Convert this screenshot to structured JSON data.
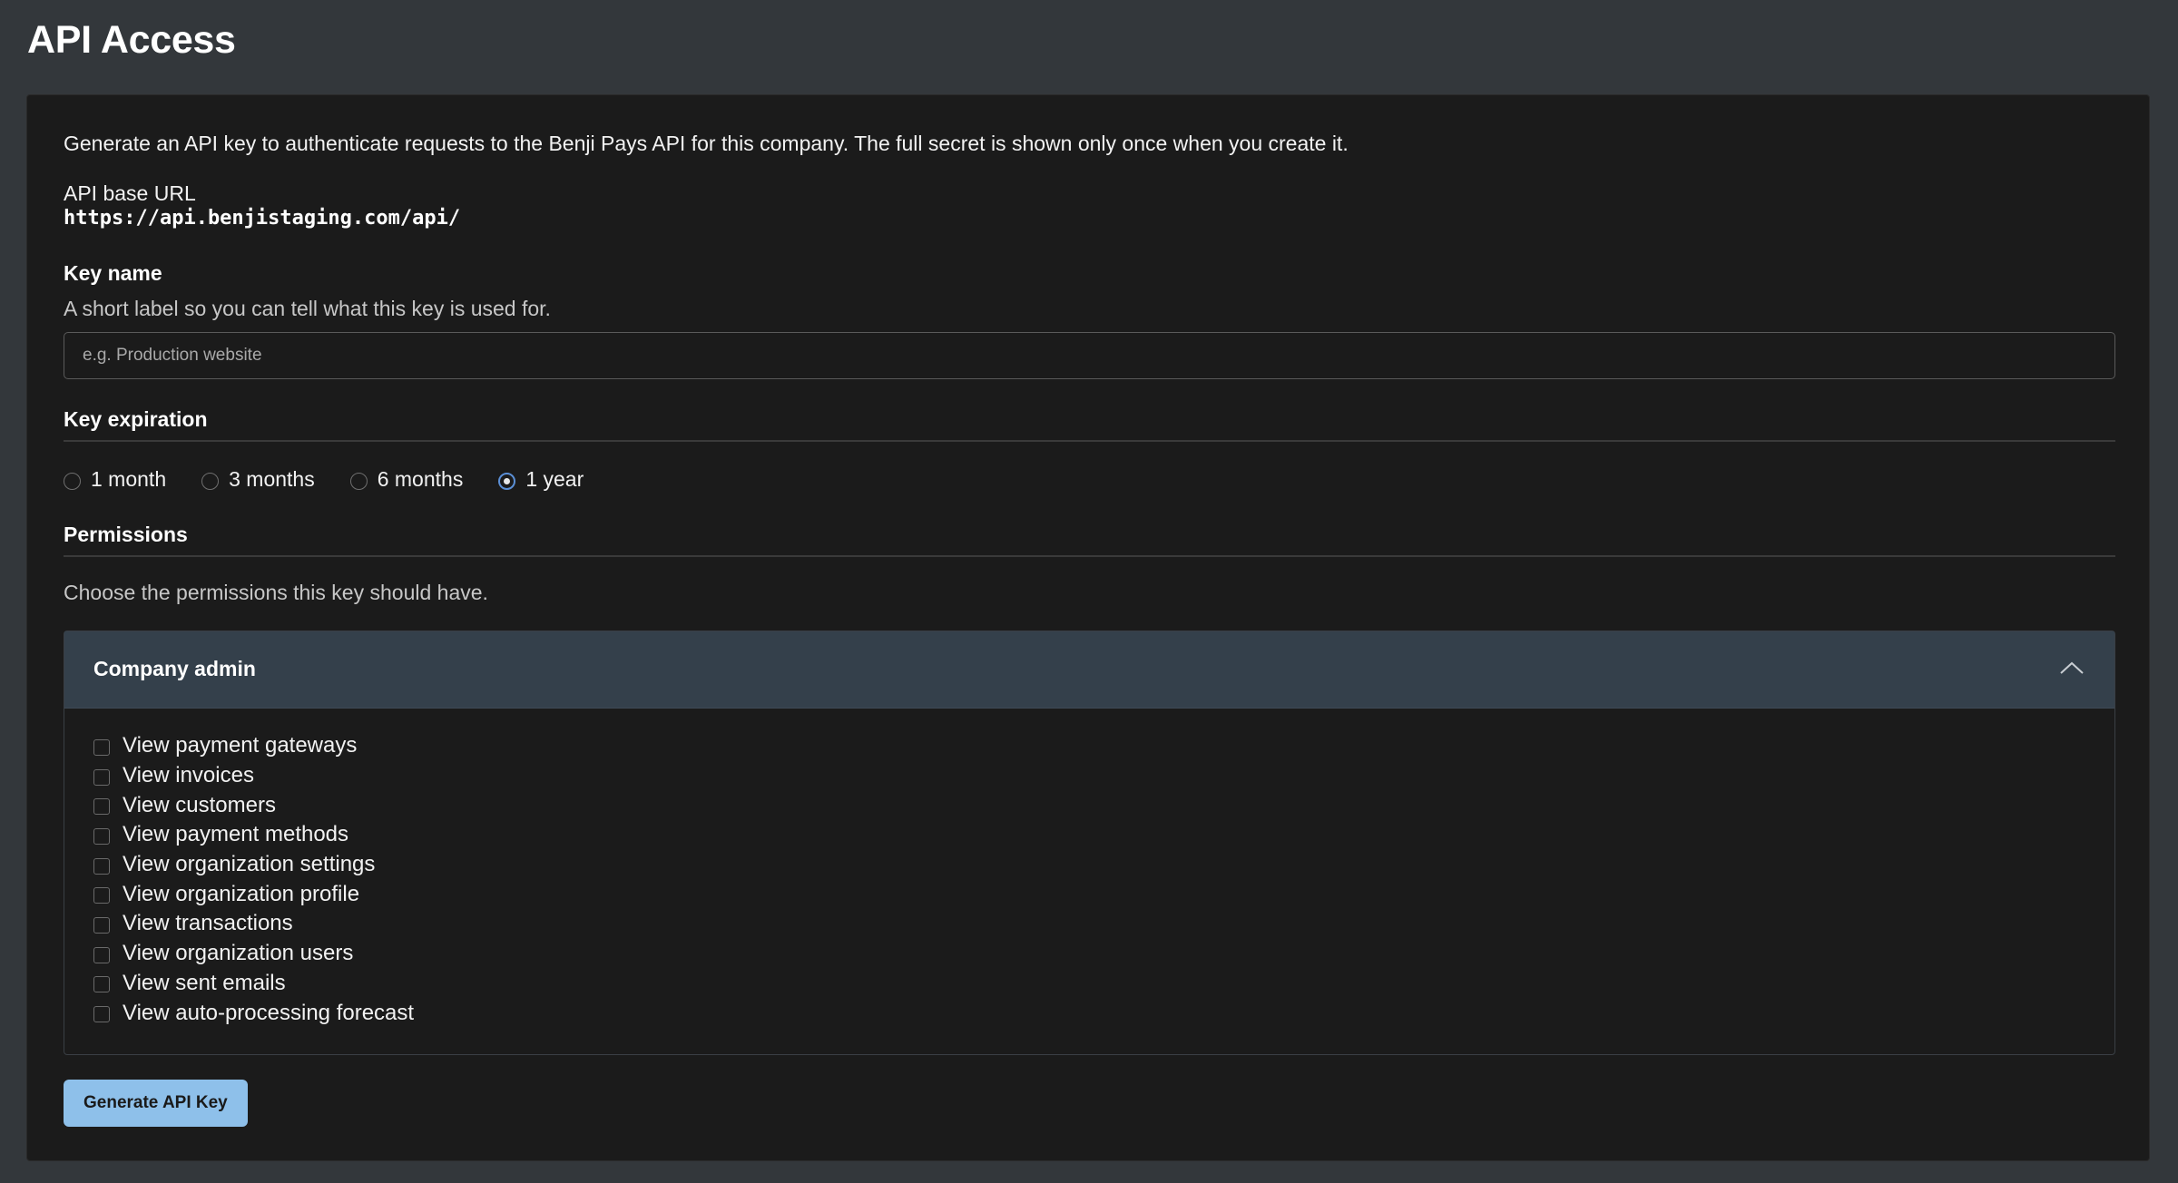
{
  "page": {
    "title": "API Access"
  },
  "card": {
    "intro": "Generate an API key to authenticate requests to the Benji Pays API for this company. The full secret is shown only once when you create it.",
    "base_url_label": "API base URL",
    "base_url": "https://api.benjistaging.com/api/"
  },
  "key_name": {
    "label": "Key name",
    "help": "A short label so you can tell what this key is used for.",
    "value": "",
    "placeholder": "e.g. Production website"
  },
  "expiration": {
    "label": "Key expiration",
    "options": [
      {
        "label": "1 month",
        "checked": false
      },
      {
        "label": "3 months",
        "checked": false
      },
      {
        "label": "6 months",
        "checked": false
      },
      {
        "label": "1 year",
        "checked": true
      }
    ],
    "selected": "1 year"
  },
  "permissions": {
    "label": "Permissions",
    "help": "Choose the permissions this key should have.",
    "group": {
      "title": "Company admin",
      "expanded": true,
      "items": [
        {
          "label": "View payment gateways",
          "checked": false
        },
        {
          "label": "View invoices",
          "checked": false
        },
        {
          "label": "View customers",
          "checked": false
        },
        {
          "label": "View payment methods",
          "checked": false
        },
        {
          "label": "View organization settings",
          "checked": false
        },
        {
          "label": "View organization profile",
          "checked": false
        },
        {
          "label": "View transactions",
          "checked": false
        },
        {
          "label": "View organization users",
          "checked": false
        },
        {
          "label": "View sent emails",
          "checked": false
        },
        {
          "label": "View auto-processing forecast",
          "checked": false
        }
      ]
    }
  },
  "actions": {
    "generate_label": "Generate API Key"
  },
  "icons": {
    "collapse": "chevron-up-icon"
  },
  "colors": {
    "page_background": "#33373b",
    "card_background": "#1b1b1b",
    "panel_header": "#34404b",
    "primary_button": "#8ec0ea",
    "radio_accent": "#5b8fd6"
  }
}
